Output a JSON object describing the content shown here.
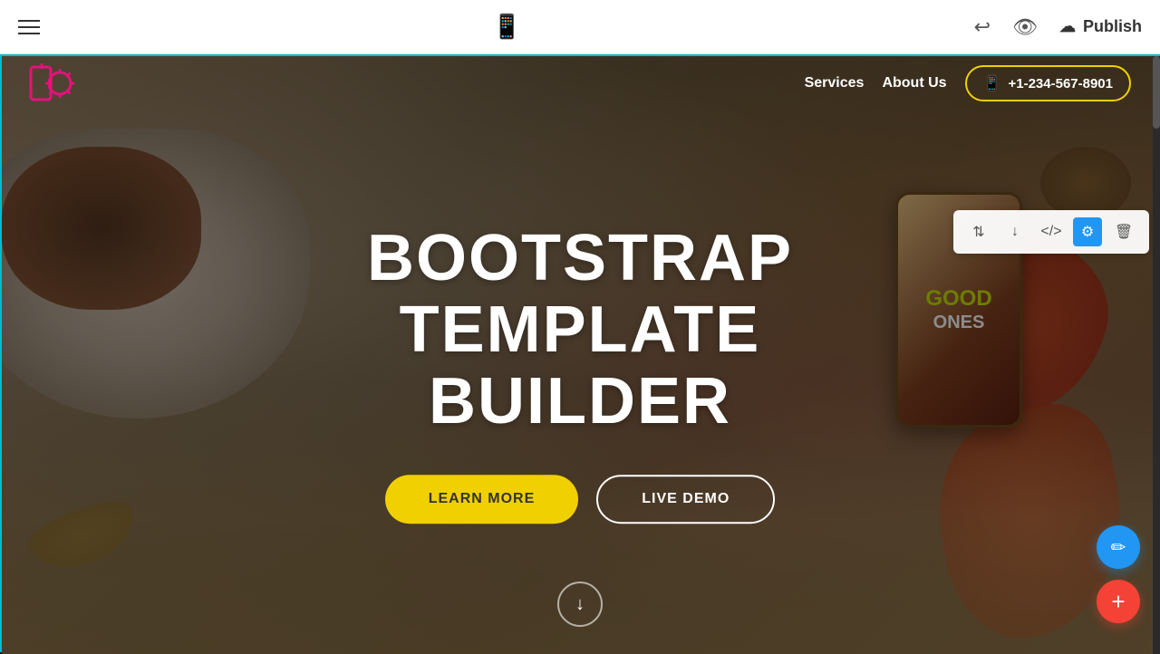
{
  "toolbar": {
    "publish_label": "Publish",
    "hamburger_aria": "Menu",
    "mobile_preview_aria": "Mobile preview",
    "undo_aria": "Undo",
    "preview_aria": "Preview",
    "cloud_aria": "Cloud save"
  },
  "nav": {
    "services_label": "Services",
    "about_label": "About Us",
    "phone_number": "+1-234-567-8901"
  },
  "hero": {
    "title_line1": "BOOTSTRAP",
    "title_line2": "TEMPLATE BUILDER",
    "learn_more": "LEARN MORE",
    "live_demo": "LIVE DEMO"
  },
  "section_tools": {
    "sort_icon": "⇅",
    "download_icon": "↓",
    "code_icon": "</>",
    "settings_icon": "⚙",
    "delete_icon": "🗑"
  },
  "fabs": {
    "pencil_icon": "✏",
    "plus_icon": "+"
  },
  "scroll_arrow": "↓"
}
